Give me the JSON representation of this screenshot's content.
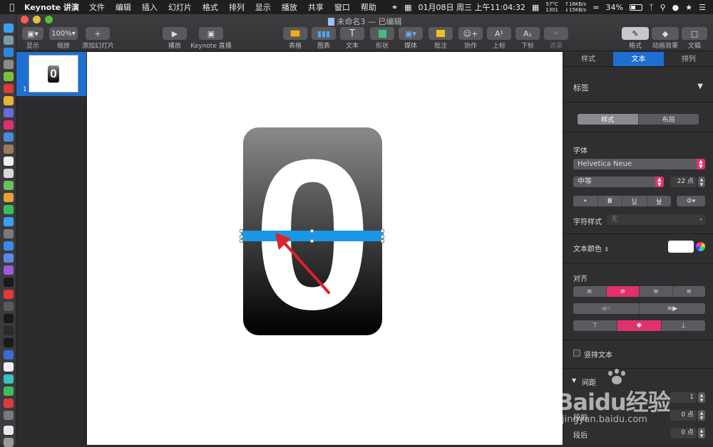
{
  "menubar": {
    "apple": "",
    "app": "Keynote 讲演",
    "items": [
      "文件",
      "编辑",
      "插入",
      "幻灯片",
      "格式",
      "排列",
      "显示",
      "播放",
      "共享",
      "窗口",
      "帮助"
    ],
    "temp": "57°C",
    "temp_sub": "1301",
    "net_up": "↑16KB/s",
    "net_down": "↓15KB/s",
    "datetime": "01月08日 周三 上午11:04:32",
    "battery": "34%"
  },
  "window": {
    "doc_title": "未命名3 — 已编辑"
  },
  "toolbar": {
    "view": "显示",
    "zoom_value": "100%",
    "zoom": "缩放",
    "add_slide": "添加幻灯片",
    "play": "播放",
    "keynote_live": "Keynote 直播",
    "table": "表格",
    "chart": "图表",
    "text": "文本",
    "shape": "形状",
    "media": "媒体",
    "comment": "批注",
    "collaborate": "协作",
    "superscript": "上标",
    "subscript": "下标",
    "mask": "遮罩",
    "format": "格式",
    "animate": "动画效果",
    "document": "文稿"
  },
  "slides": {
    "number": "1"
  },
  "slide": {
    "digit": "0"
  },
  "inspector": {
    "tabs": [
      "样式",
      "文本",
      "排列"
    ],
    "paragraph_style": "标签",
    "subtabs": [
      "样式",
      "布局"
    ],
    "font_label": "字体",
    "font_name": "Helvetica Neue",
    "font_weight": "中等",
    "font_size": "22 点",
    "char_style_label": "字符样式",
    "char_style_value": "无",
    "text_color_label": "文本颜色",
    "align_label": "对齐",
    "vertical_text": "竖排文本",
    "spacing_label": "间距",
    "spacing_value": "1",
    "before_para": "段前",
    "before_value": "0 点",
    "after_para": "段后",
    "after_value": "0 点",
    "bold": "B",
    "italic": "I",
    "underline": "U",
    "strike": "U"
  },
  "watermark": {
    "text": "Baidu经验",
    "url": "jingyan.baidu.com"
  },
  "colors": {
    "accent_blue": "#1d6fd1",
    "accent_pink": "#e0306e",
    "label_bar": "#1a96e6",
    "arrow": "#e0202a"
  }
}
